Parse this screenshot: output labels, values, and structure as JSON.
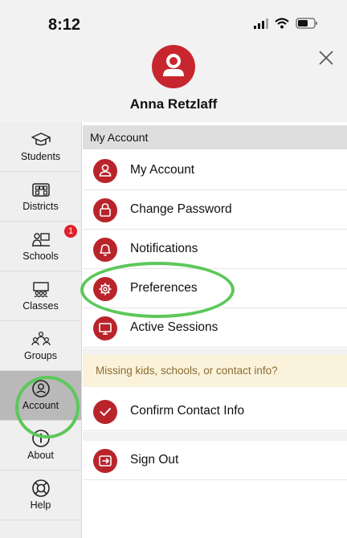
{
  "status_bar": {
    "time": "8:12"
  },
  "profile": {
    "name": "Anna Retzlaff"
  },
  "sidebar": {
    "items": [
      {
        "label": "Students"
      },
      {
        "label": "Districts"
      },
      {
        "label": "Schools",
        "badge": "1"
      },
      {
        "label": "Classes"
      },
      {
        "label": "Groups"
      },
      {
        "label": "Account"
      },
      {
        "label": "About"
      },
      {
        "label": "Help"
      }
    ]
  },
  "main": {
    "section_title": "My Account",
    "items": [
      {
        "label": "My Account",
        "icon": "person-icon"
      },
      {
        "label": "Change Password",
        "icon": "lock-icon"
      },
      {
        "label": "Notifications",
        "icon": "bell-icon"
      },
      {
        "label": "Preferences",
        "icon": "gear-icon"
      },
      {
        "label": "Active Sessions",
        "icon": "monitor-icon"
      }
    ],
    "warning": "Missing kids, schools, or contact info?",
    "confirm": {
      "label": "Confirm Contact Info",
      "icon": "check-icon"
    },
    "signout": {
      "label": "Sign Out",
      "icon": "sign-out-icon"
    }
  },
  "colors": {
    "accent": "#c8262e",
    "highlight": "#5cc85a",
    "badge": "#e0202a"
  }
}
